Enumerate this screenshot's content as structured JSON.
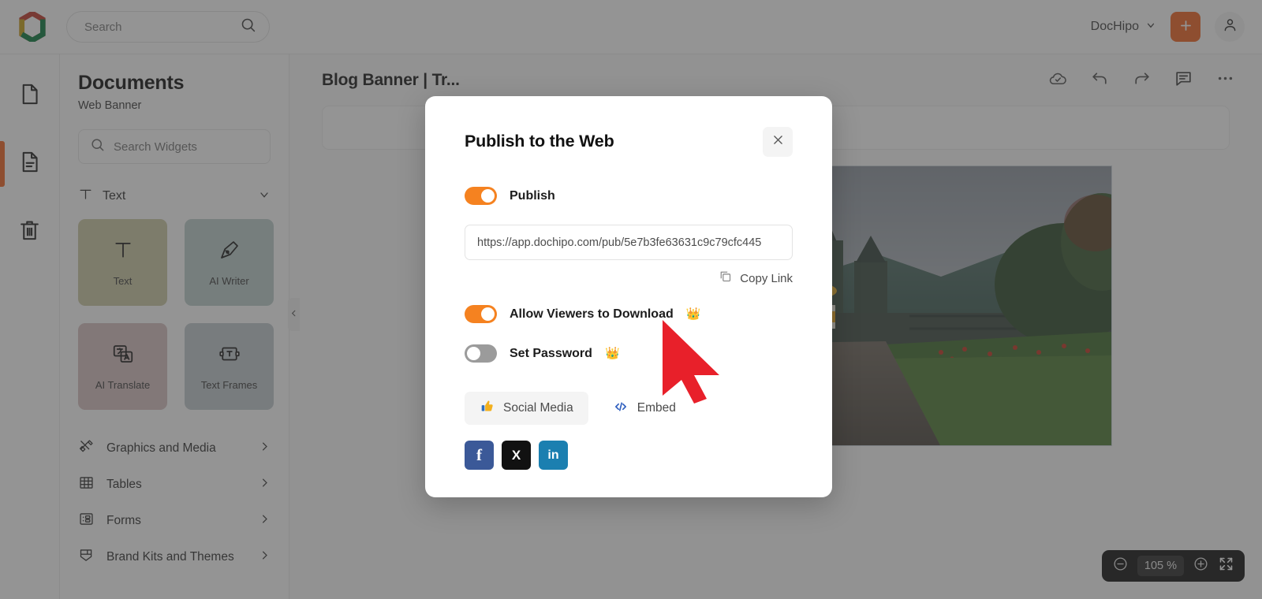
{
  "topbar": {
    "logo_icon": "dochipo-hexagon-logo",
    "search_placeholder": "Search",
    "search_icon": "search-icon",
    "workspace": "DocHipo",
    "chevron_icon": "chevron-down-icon",
    "add_label": "+",
    "add_icon": "plus-icon",
    "account_icon": "user-account-icon",
    "accent": "#f26522"
  },
  "rail": {
    "items": [
      {
        "icon": "page-blank-icon",
        "name": "pages"
      },
      {
        "icon": "page-text-icon",
        "name": "document-layers",
        "active": true
      },
      {
        "icon": "trash-icon",
        "name": "trash"
      }
    ]
  },
  "panel": {
    "title": "Documents",
    "subtitle": "Web Banner",
    "search_placeholder": "Search Widgets",
    "search_icon": "search-icon",
    "section": {
      "label": "Text",
      "icon": "text-T-icon",
      "chevron": "chevron-down-icon"
    },
    "cards": [
      {
        "label": "Text",
        "icon": "text-T-icon",
        "bg": "#cdc9a5"
      },
      {
        "label": "AI Writer",
        "icon": "pen-nib-icon",
        "bg": "#bdcfcd"
      },
      {
        "label": "AI Translate",
        "icon": "translate-icon",
        "bg": "#d7c0c0"
      },
      {
        "label": "Text Frames",
        "icon": "text-frame-icon",
        "bg": "#c2cace"
      }
    ],
    "menu": [
      {
        "label": "Graphics and Media",
        "icon": "graphics-media-icon",
        "chevron": "chevron-right-icon"
      },
      {
        "label": "Tables",
        "icon": "table-grid-icon",
        "chevron": "chevron-right-icon"
      },
      {
        "label": "Forms",
        "icon": "forms-icon",
        "chevron": "chevron-right-icon"
      },
      {
        "label": "Brand Kits and Themes",
        "icon": "brand-kit-icon",
        "chevron": "chevron-right-icon"
      }
    ],
    "collapse_icon": "chevron-left-icon"
  },
  "editor": {
    "doc_title": "Blog Banner | Tr...",
    "actions": [
      {
        "icon": "cloud-saved-icon",
        "name": "cloud-save"
      },
      {
        "icon": "undo-arrow-icon",
        "name": "undo"
      },
      {
        "icon": "redo-arrow-icon",
        "name": "redo"
      },
      {
        "icon": "comment-icon",
        "name": "comments"
      },
      {
        "icon": "more-horizontal-icon",
        "name": "more-options"
      }
    ],
    "zoom": {
      "minus_icon": "zoom-out-circle-icon",
      "value": "105 %",
      "plus_icon": "zoom-in-circle-icon",
      "fullscreen_icon": "fit-screen-icon"
    }
  },
  "modal": {
    "title": "Publish to the Web",
    "close_icon": "close-x-icon",
    "publish": {
      "label": "Publish",
      "state": "on"
    },
    "url": "https://app.dochipo.com/pub/5e7b3fe63631c9c79cfc445",
    "copy": {
      "label": "Copy Link",
      "icon": "copy-icon"
    },
    "download": {
      "label": "Allow Viewers to Download",
      "state": "on",
      "badge": "crown-icon"
    },
    "password": {
      "label": "Set Password",
      "state": "off",
      "badge": "crown-icon"
    },
    "tabs": [
      {
        "label": "Social Media",
        "icon": "thumbs-up-icon",
        "selected": true
      },
      {
        "label": "Embed",
        "icon": "code-brackets-icon",
        "selected": false
      }
    ],
    "socials": [
      {
        "name": "facebook-share-button",
        "glyph": "f",
        "color": "#3b5998"
      },
      {
        "name": "x-twitter-share-button",
        "glyph": "X",
        "color": "#111111"
      },
      {
        "name": "linkedin-share-button",
        "glyph": "in",
        "color": "#1b7fb0"
      }
    ]
  },
  "cursor": {
    "icon": "mouse-arrow-pointer",
    "color": "#e8202a"
  }
}
